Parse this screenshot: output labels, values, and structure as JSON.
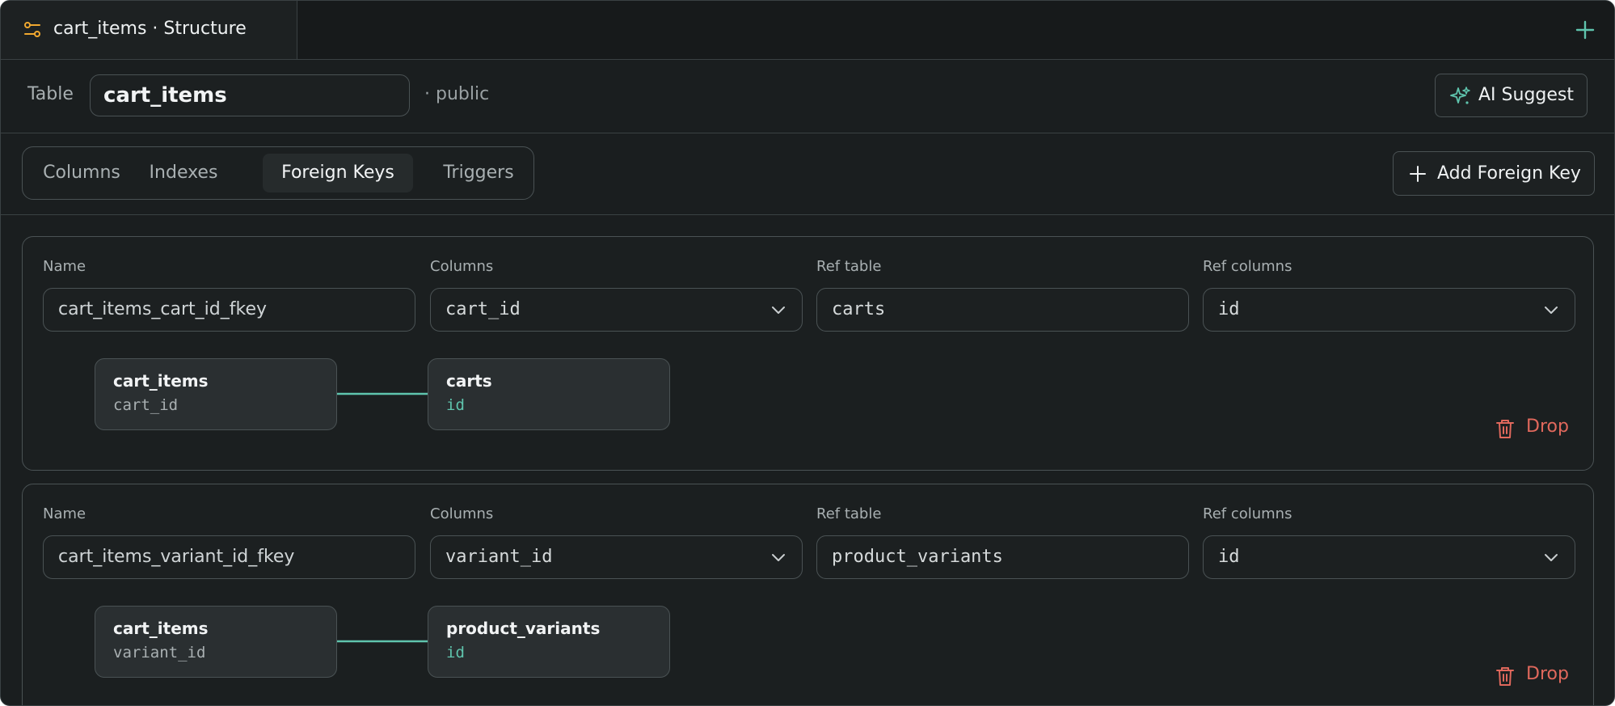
{
  "tab": {
    "title": "cart_items · Structure"
  },
  "table_bar": {
    "label": "Table",
    "name": "cart_items",
    "schema": "· public",
    "ai_button": "AI Suggest"
  },
  "subtabs": {
    "items": [
      {
        "label": "Columns"
      },
      {
        "label": "Indexes"
      },
      {
        "label": "Foreign Keys"
      },
      {
        "label": "Triggers"
      }
    ],
    "active": "Foreign Keys",
    "add_button": "Add Foreign Key"
  },
  "field_labels": {
    "name": "Name",
    "columns": "Columns",
    "ref_table": "Ref table",
    "ref_columns": "Ref columns"
  },
  "foreign_keys": [
    {
      "name": "cart_items_cart_id_fkey",
      "columns": "cart_id",
      "ref_table": "carts",
      "ref_columns": "id",
      "source_table": "cart_items",
      "source_column": "cart_id",
      "target_table": "carts",
      "target_column": "id",
      "drop_label": "Drop"
    },
    {
      "name": "cart_items_variant_id_fkey",
      "columns": "variant_id",
      "ref_table": "product_variants",
      "ref_columns": "id",
      "source_table": "cart_items",
      "source_column": "variant_id",
      "target_table": "product_variants",
      "target_column": "id",
      "drop_label": "Drop"
    }
  ],
  "colors": {
    "accent": "#5fc4ad",
    "danger": "#e0685c",
    "tab_icon": "#f0a830",
    "background": "#1a1e1f"
  },
  "icons": {
    "tab": "table-structure-icon",
    "new_tab": "plus-icon",
    "ai": "sparkle-icon",
    "add": "plus-icon",
    "dropdown": "chevron-down-icon",
    "drop": "trash-icon"
  }
}
